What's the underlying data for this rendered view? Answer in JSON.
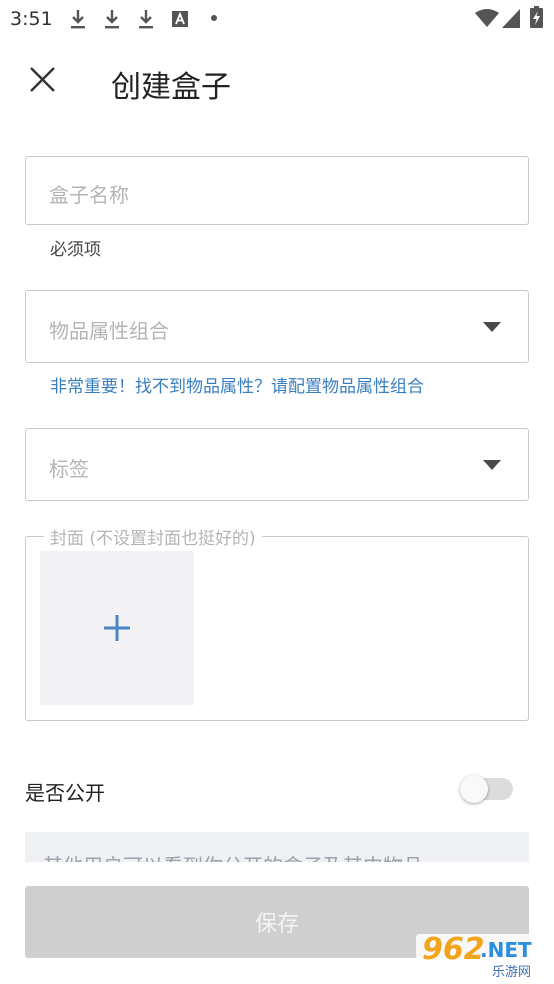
{
  "status_bar": {
    "time": "3:51",
    "icons": [
      "download-icon",
      "download-icon",
      "download-icon",
      "a-icon",
      "dot-icon",
      "wifi-icon",
      "signal-icon",
      "battery-charging-icon"
    ]
  },
  "header": {
    "title": "创建盒子",
    "close_icon": "close-icon"
  },
  "box_name": {
    "placeholder": "盒子名称",
    "helper": "必须项"
  },
  "attributes": {
    "placeholder": "物品属性组合",
    "hint": "非常重要！找不到物品属性？请配置物品属性组合",
    "hint_color": "#3a7fc1"
  },
  "tags": {
    "placeholder": "标签"
  },
  "cover": {
    "legend": "封面 (不设置封面也挺好的)",
    "add_icon": "plus-icon",
    "add_color": "#4a86c5"
  },
  "public": {
    "label": "是否公开",
    "enabled": false
  },
  "description": {
    "text": "其他用户可以看到你公开的盒子及其中物品"
  },
  "save": {
    "label": "保存"
  },
  "watermark": {
    "number": "962",
    "suffix": ".NET",
    "subtitle": "乐游网"
  }
}
